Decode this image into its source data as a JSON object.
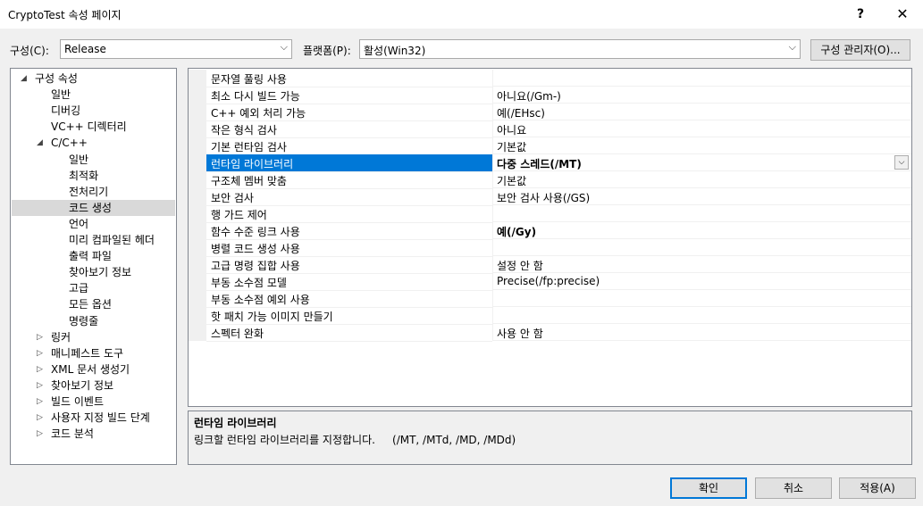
{
  "window": {
    "title": "CryptoTest 속성 페이지",
    "help_label": "?",
    "close_label": "✕"
  },
  "toolbar": {
    "config_label": "구성(C):",
    "config_value": "Release",
    "platform_label": "플랫폼(P):",
    "platform_value": "활성(Win32)",
    "manager_button": "구성 관리자(O)..."
  },
  "tree": [
    {
      "label": "구성 속성",
      "level": 0,
      "expander": "◢"
    },
    {
      "label": "일반",
      "level": 1
    },
    {
      "label": "디버깅",
      "level": 1
    },
    {
      "label": "VC++ 디렉터리",
      "level": 1
    },
    {
      "label": "C/C++",
      "level": 1,
      "expander": "◢"
    },
    {
      "label": "일반",
      "level": 2
    },
    {
      "label": "최적화",
      "level": 2
    },
    {
      "label": "전처리기",
      "level": 2
    },
    {
      "label": "코드 생성",
      "level": 2,
      "selected": true
    },
    {
      "label": "언어",
      "level": 2
    },
    {
      "label": "미리 컴파일된 헤더",
      "level": 2
    },
    {
      "label": "출력 파일",
      "level": 2
    },
    {
      "label": "찾아보기 정보",
      "level": 2
    },
    {
      "label": "고급",
      "level": 2
    },
    {
      "label": "모든 옵션",
      "level": 2
    },
    {
      "label": "명령줄",
      "level": 2
    },
    {
      "label": "링커",
      "level": 1,
      "expander": "▷"
    },
    {
      "label": "매니페스트 도구",
      "level": 1,
      "expander": "▷"
    },
    {
      "label": "XML 문서 생성기",
      "level": 1,
      "expander": "▷"
    },
    {
      "label": "찾아보기 정보",
      "level": 1,
      "expander": "▷"
    },
    {
      "label": "빌드 이벤트",
      "level": 1,
      "expander": "▷"
    },
    {
      "label": "사용자 지정 빌드 단계",
      "level": 1,
      "expander": "▷"
    },
    {
      "label": "코드 분석",
      "level": 1,
      "expander": "▷"
    }
  ],
  "properties": [
    {
      "name": "문자열 풀링 사용",
      "value": ""
    },
    {
      "name": "최소 다시 빌드 가능",
      "value": "아니요(/Gm-)"
    },
    {
      "name": "C++ 예외 처리 가능",
      "value": "예(/EHsc)"
    },
    {
      "name": "작은 형식 검사",
      "value": "아니요"
    },
    {
      "name": "기본 런타임 검사",
      "value": "기본값"
    },
    {
      "name": "런타임 라이브러리",
      "value": "다중 스레드(/MT)",
      "selected": true,
      "bold": true
    },
    {
      "name": "구조체 멤버 맞춤",
      "value": "기본값"
    },
    {
      "name": "보안 검사",
      "value": "보안 검사 사용(/GS)"
    },
    {
      "name": "행 가드 제어",
      "value": ""
    },
    {
      "name": "함수 수준 링크 사용",
      "value": "예(/Gy)",
      "bold": true
    },
    {
      "name": "병렬 코드 생성 사용",
      "value": ""
    },
    {
      "name": "고급 명령 집합 사용",
      "value": "설정 안 함"
    },
    {
      "name": "부동 소수점 모델",
      "value": "Precise(/fp:precise)"
    },
    {
      "name": "부동 소수점 예외 사용",
      "value": ""
    },
    {
      "name": "핫 패치 가능 이미지 만들기",
      "value": ""
    },
    {
      "name": "스펙터 완화",
      "value": "사용 안 함"
    }
  ],
  "description": {
    "title": "런타임 라이브러리",
    "text": "링크할 런타임 라이브러리를 지정합니다.     (/MT, /MTd, /MD, /MDd)"
  },
  "buttons": {
    "ok": "확인",
    "cancel": "취소",
    "apply": "적용(A)"
  },
  "icons": {
    "dropdown": "chevron-down-icon",
    "expanded": "expanded-triangle-icon",
    "collapsed": "collapsed-triangle-icon"
  },
  "colors": {
    "accent": "#0078d7",
    "tree_selection": "#d9d9d9"
  }
}
